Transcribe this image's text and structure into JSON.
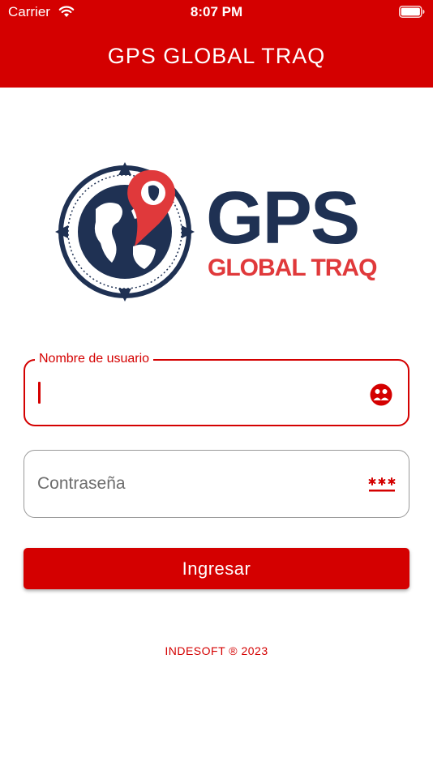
{
  "status_bar": {
    "carrier": "Carrier",
    "time": "8:07 PM",
    "wifi_icon": "wifi-icon",
    "battery_icon": "battery-icon"
  },
  "header": {
    "title": "GPS GLOBAL TRAQ",
    "background_color": "#d40000"
  },
  "logo": {
    "primary_text": "GPS",
    "secondary_text": "GLOBAL TRAQ",
    "primary_color": "#1f3153",
    "accent_color": "#e0393b"
  },
  "form": {
    "username": {
      "label": "Nombre de usuario",
      "value": "",
      "icon": "user-circle-icon"
    },
    "password": {
      "placeholder": "Contraseña",
      "value": "",
      "icon": "password-asterisks-icon"
    },
    "submit_label": "Ingresar"
  },
  "footer": {
    "text": "INDESOFT ® 2023"
  },
  "colors": {
    "accent": "#d40000",
    "border_inactive": "#9a9a9a"
  }
}
